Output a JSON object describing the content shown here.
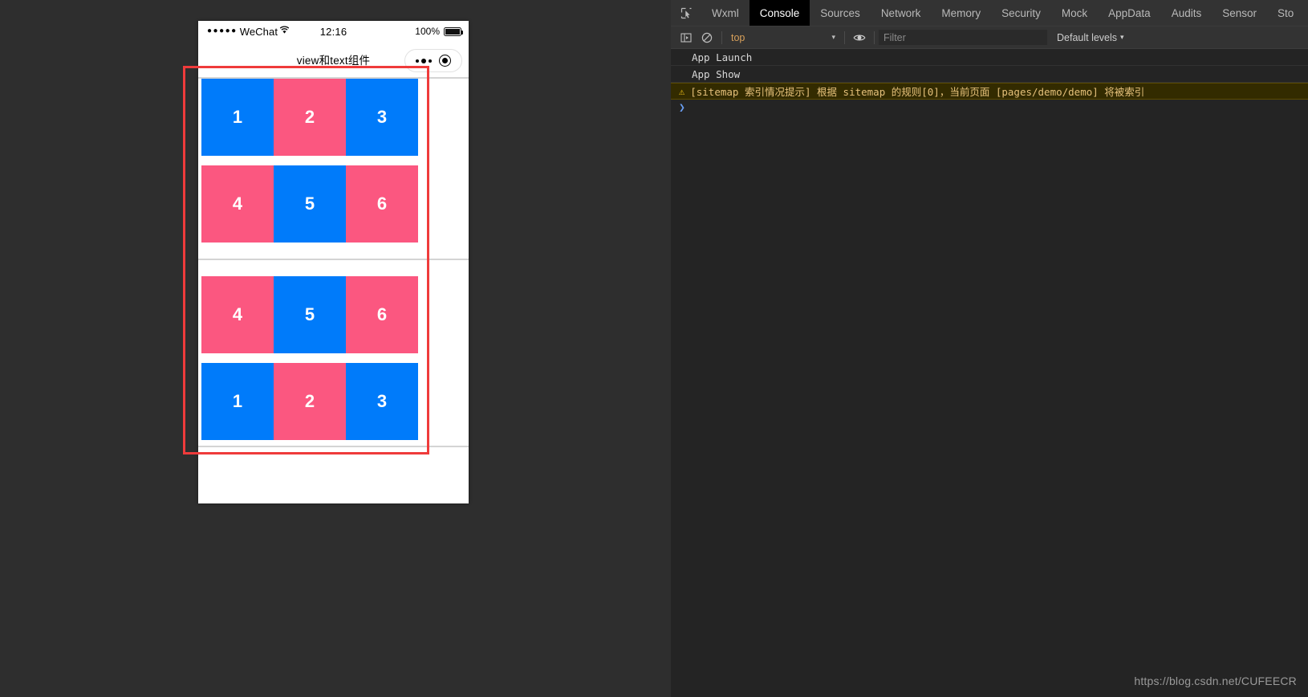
{
  "simulator": {
    "status_bar": {
      "signal_dots": "●●●●●",
      "carrier": "WeChat",
      "wifi_icon": "wifi-icon",
      "time": "12:16",
      "battery_percent": "100%"
    },
    "nav_bar": {
      "title": "view和text组件",
      "capsule": {
        "more_icon": "more-dots-icon",
        "target_icon": "target-circle-icon"
      }
    },
    "page": {
      "groups": [
        {
          "name": "group-row-direction",
          "rows": [
            {
              "cells": [
                {
                  "label": "1",
                  "color": "#007bfa"
                },
                {
                  "label": "2",
                  "color": "#fb5780"
                },
                {
                  "label": "3",
                  "color": "#007bfa"
                }
              ]
            },
            {
              "cells": [
                {
                  "label": "4",
                  "color": "#fb5780"
                },
                {
                  "label": "5",
                  "color": "#007bfa"
                },
                {
                  "label": "6",
                  "color": "#fb5780"
                }
              ]
            }
          ]
        },
        {
          "name": "group-row-reverse-direction",
          "rows": [
            {
              "cells": [
                {
                  "label": "4",
                  "color": "#fb5780"
                },
                {
                  "label": "5",
                  "color": "#007bfa"
                },
                {
                  "label": "6",
                  "color": "#fb5780"
                }
              ]
            },
            {
              "cells": [
                {
                  "label": "1",
                  "color": "#007bfa"
                },
                {
                  "label": "2",
                  "color": "#fb5780"
                },
                {
                  "label": "3",
                  "color": "#007bfa"
                }
              ]
            }
          ]
        }
      ]
    },
    "annotation": {
      "name": "red-highlight-rectangle",
      "color": "#ef3b3b"
    }
  },
  "devtools": {
    "inspect_icon": "inspect-element-icon",
    "tabs": [
      {
        "label": "Wxml",
        "active": false
      },
      {
        "label": "Console",
        "active": true
      },
      {
        "label": "Sources",
        "active": false
      },
      {
        "label": "Network",
        "active": false
      },
      {
        "label": "Memory",
        "active": false
      },
      {
        "label": "Security",
        "active": false
      },
      {
        "label": "Mock",
        "active": false
      },
      {
        "label": "AppData",
        "active": false
      },
      {
        "label": "Audits",
        "active": false
      },
      {
        "label": "Sensor",
        "active": false
      },
      {
        "label": "Sto",
        "active": false
      }
    ],
    "toolbar": {
      "sidebar_icon": "console-sidebar-icon",
      "clear_icon": "clear-console-icon",
      "context_value": "top",
      "eye_icon": "live-expression-eye-icon",
      "filter_placeholder": "Filter",
      "filter_value": "",
      "levels_label": "Default levels",
      "caret": "▾"
    },
    "console_entries": [
      {
        "type": "log",
        "text": "App Launch"
      },
      {
        "type": "log",
        "text": "App Show"
      },
      {
        "type": "warn",
        "icon": "warning-triangle-icon",
        "text": "[sitemap 索引情况提示] 根据 sitemap 的规则[0]，当前页面 [pages/demo/demo] 将被索引"
      },
      {
        "type": "prompt",
        "text": "❯"
      }
    ]
  },
  "watermark": {
    "text": "https://blog.csdn.net/CUFEECR"
  }
}
